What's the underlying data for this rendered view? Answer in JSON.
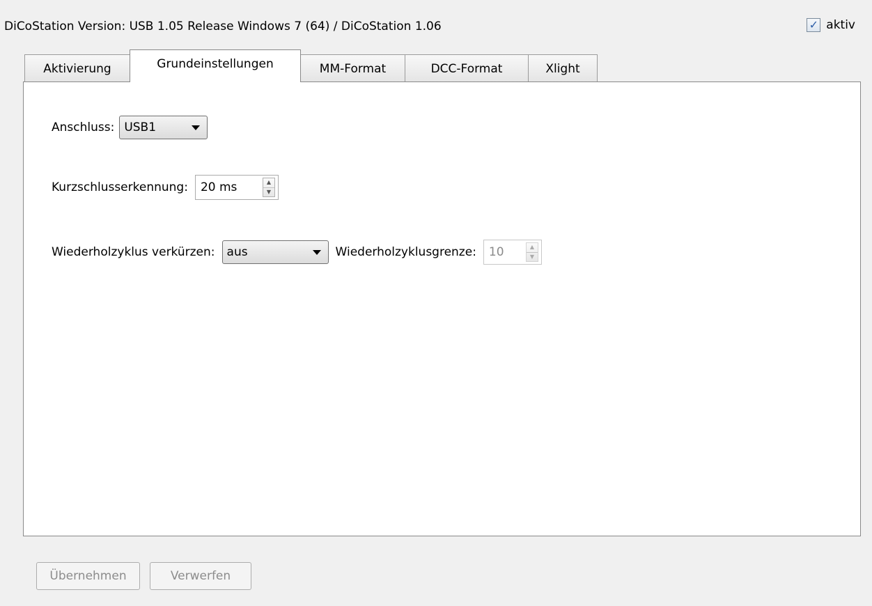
{
  "header": {
    "title": "DiCoStation  Version:  USB 1.05 Release Windows 7 (64) / DiCoStation 1.06",
    "aktiv_label": "aktiv",
    "aktiv_checked": true
  },
  "tabs": [
    {
      "label": "Aktivierung",
      "active": false
    },
    {
      "label": "Grundeinstellungen",
      "active": true
    },
    {
      "label": "MM-Format",
      "active": false
    },
    {
      "label": "DCC-Format",
      "active": false
    },
    {
      "label": "Xlight",
      "active": false
    }
  ],
  "grundeinstellungen": {
    "anschluss": {
      "label": "Anschluss:",
      "value": "USB1"
    },
    "kurzschluss": {
      "label": "Kurzschlusserkennung:",
      "value": "20 ms"
    },
    "wiederholzyklus": {
      "label": "Wiederholzyklus verkürzen:",
      "value": "aus"
    },
    "wiederholzyklusgrenze": {
      "label": "Wiederholzyklusgrenze:",
      "value": "10",
      "disabled": true
    }
  },
  "buttons": {
    "apply_label": "Übernehmen",
    "discard_label": "Verwerfen"
  },
  "icons": {
    "checkmark": "check-icon",
    "dropdown": "chevron-down-icon",
    "spin_up": "spin-up-icon",
    "spin_down": "spin-down-icon"
  }
}
